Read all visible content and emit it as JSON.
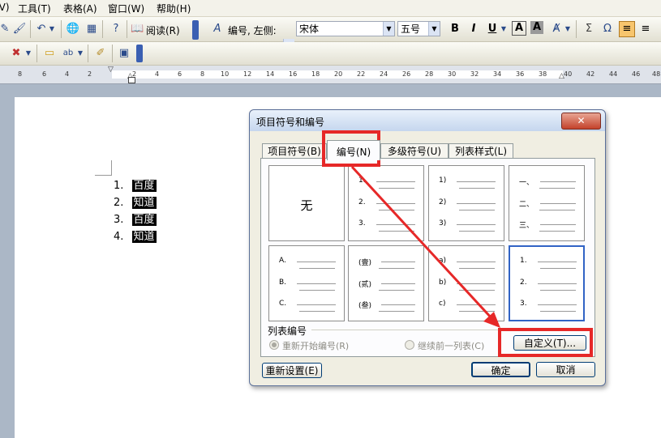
{
  "menubar": {
    "items": [
      {
        "label": "(V)"
      },
      {
        "label": "工具(T)"
      },
      {
        "label": "表格(A)"
      },
      {
        "label": "窗口(W)"
      },
      {
        "label": "帮助(H)"
      }
    ]
  },
  "toolbar": {
    "read_label": "阅读(R)",
    "style_value": "编号, 左侧:",
    "font_value": "宋体",
    "size_value": "五号"
  },
  "ruler": {
    "ticks": [
      "8",
      "6",
      "4",
      "2",
      "2",
      "4",
      "6",
      "8",
      "10",
      "12",
      "14",
      "16",
      "18",
      "20",
      "22",
      "24",
      "26",
      "28",
      "30",
      "32",
      "34",
      "36",
      "38",
      "40",
      "42",
      "44",
      "46",
      "48"
    ]
  },
  "document": {
    "list": [
      {
        "num": "1.",
        "text": "百度"
      },
      {
        "num": "2.",
        "text": "知道"
      },
      {
        "num": "3.",
        "text": "百度"
      },
      {
        "num": "4.",
        "text": "知道"
      }
    ]
  },
  "dialog": {
    "title": "项目符号和编号",
    "close_label": "✕",
    "tabs": [
      {
        "label": "项目符号(B)"
      },
      {
        "label": "编号(N)"
      },
      {
        "label": "多级符号(U)"
      },
      {
        "label": "列表样式(L)"
      }
    ],
    "none_label": "无",
    "gallery": [
      {
        "markers": [
          "1.",
          "2.",
          "3."
        ]
      },
      {
        "markers": [
          "1)",
          "2)",
          "3)"
        ]
      },
      {
        "markers": [
          "一、",
          "二、",
          "三、"
        ]
      },
      {
        "markers": [
          "A.",
          "B.",
          "C."
        ]
      },
      {
        "markers": [
          "(壹)",
          "(贰)",
          "(叁)"
        ]
      },
      {
        "markers": [
          "a)",
          "b)",
          "c)"
        ]
      },
      {
        "markers": [
          "1.",
          "2.",
          "3."
        ]
      }
    ],
    "group_caption": "列表编号",
    "radio_restart": "重新开始编号(R)",
    "radio_continue": "继续前一列表(C)",
    "customize_label": "自定义(T)...",
    "reset_label": "重新设置(E)",
    "ok_label": "确定",
    "cancel_label": "取消"
  },
  "colors": {
    "annotation": "#e62828",
    "selection_border": "#3163c5"
  }
}
